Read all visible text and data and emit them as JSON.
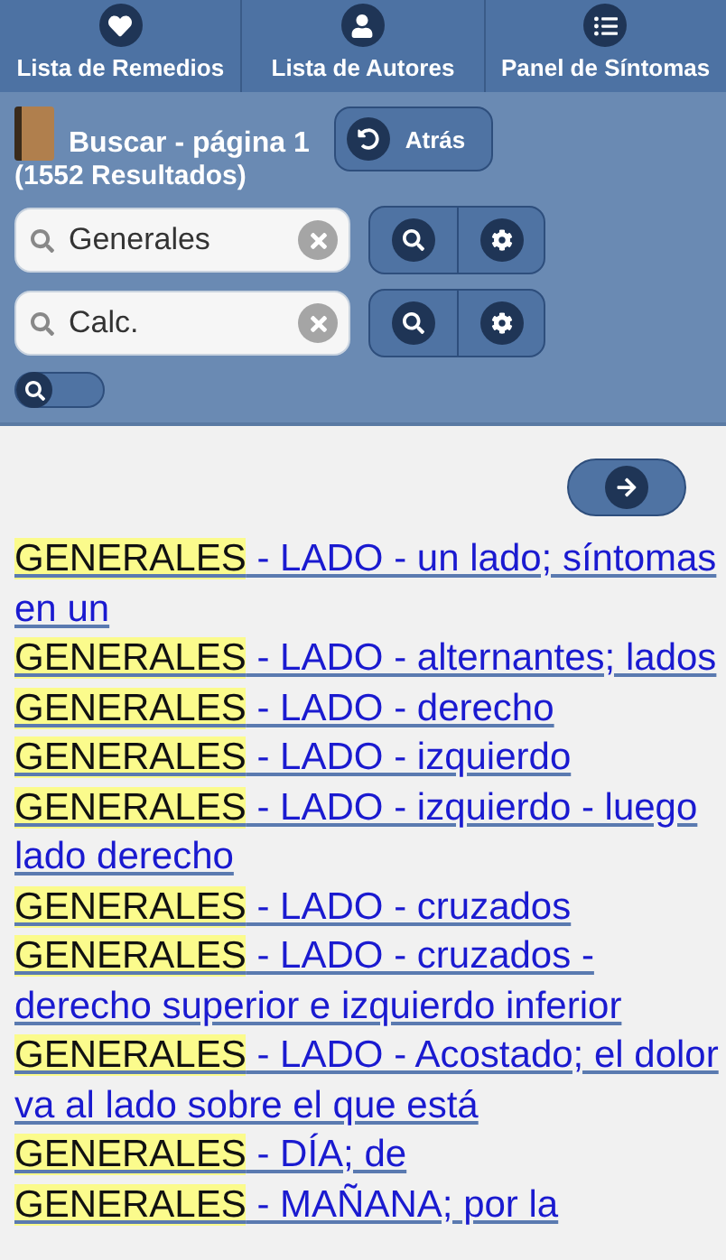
{
  "tabs": [
    {
      "label": "Lista de Remedios",
      "selected": false
    },
    {
      "label": "Lista de Autores",
      "selected": false
    },
    {
      "label": "Panel de Síntomas",
      "selected": false
    }
  ],
  "header": {
    "title": "Buscar - página 1",
    "count": "(1552 Resultados)",
    "back": "Atrás"
  },
  "searches": [
    {
      "value": "Generales"
    },
    {
      "value": "Calc."
    }
  ],
  "search_toggle": {
    "on": false
  },
  "results": [
    {
      "term": "GENERALES",
      "rest": " - LADO - un lado; síntomas en un"
    },
    {
      "term": "GENERALES",
      "rest": " - LADO - alternantes; lados"
    },
    {
      "term": "GENERALES",
      "rest": " - LADO - derecho"
    },
    {
      "term": "GENERALES",
      "rest": " - LADO - izquierdo"
    },
    {
      "term": "GENERALES",
      "rest": " - LADO - izquierdo - luego lado derecho"
    },
    {
      "term": "GENERALES",
      "rest": " - LADO - cruzados"
    },
    {
      "term": "GENERALES",
      "rest": " - LADO - cruzados - derecho superior e izquierdo inferior"
    },
    {
      "term": "GENERALES",
      "rest": " - LADO - Acostado; el dolor va al lado sobre el que está"
    },
    {
      "term": "GENERALES",
      "rest": " - DÍA; de"
    },
    {
      "term": "GENERALES",
      "rest": " - MAÑANA; por la"
    }
  ]
}
